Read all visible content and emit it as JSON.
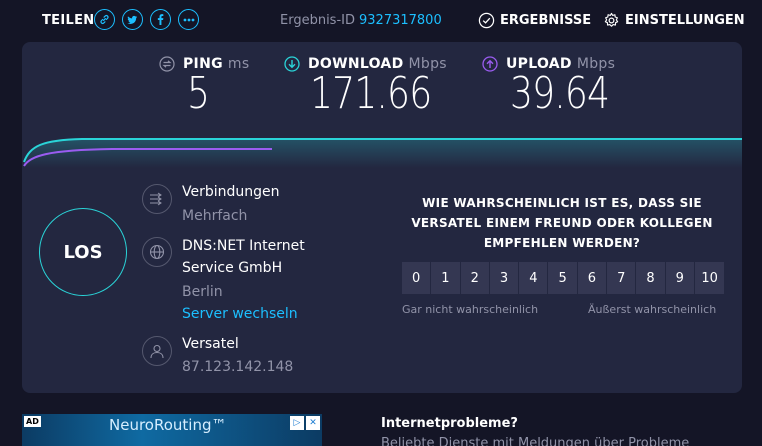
{
  "header": {
    "share_label": "TEILEN",
    "share_icons": [
      "link-icon",
      "twitter-icon",
      "facebook-icon",
      "more-icon"
    ],
    "result_label": "Ergebnis-ID",
    "result_id": "9327317800",
    "results_button": "ERGEBNISSE",
    "settings_button": "EINSTELLUNGEN"
  },
  "metrics": {
    "ping": {
      "label": "PING",
      "unit": "ms",
      "value": "5"
    },
    "download": {
      "label": "DOWNLOAD",
      "unit": "Mbps",
      "value": "171.66"
    },
    "upload": {
      "label": "UPLOAD",
      "unit": "Mbps",
      "value": "39.64"
    }
  },
  "colors": {
    "accent": "#1cbfff",
    "download": "#2ad4d8",
    "upload": "#9a5cf0",
    "panel": "#232740",
    "background": "#141526"
  },
  "go_button": "LOS",
  "connection": {
    "title": "Verbindungen",
    "value": "Mehrfach"
  },
  "server": {
    "name_line1": "DNS:NET Internet",
    "name_line2": "Service GmbH",
    "location": "Berlin",
    "change_link": "Server wechseln"
  },
  "isp": {
    "name": "Versatel",
    "ip": "87.123.142.148"
  },
  "survey": {
    "question_line1": "WIE WAHRSCHEINLICH IST ES, DASS SIE",
    "question_line2": "VERSATEL EINEM FREUND ODER KOLLEGEN",
    "question_line3": "EMPFEHLEN WERDEN?",
    "scale": [
      "0",
      "1",
      "2",
      "3",
      "4",
      "5",
      "6",
      "7",
      "8",
      "9",
      "10"
    ],
    "low_label": "Gar nicht wahrscheinlich",
    "high_label": "Äußerst wahrscheinlich"
  },
  "ad": {
    "tag": "AD",
    "title": "NeuroRouting™"
  },
  "issues": {
    "title": "Internetprobleme?",
    "subtitle": "Beliebte Dienste mit Meldungen über Probleme"
  }
}
